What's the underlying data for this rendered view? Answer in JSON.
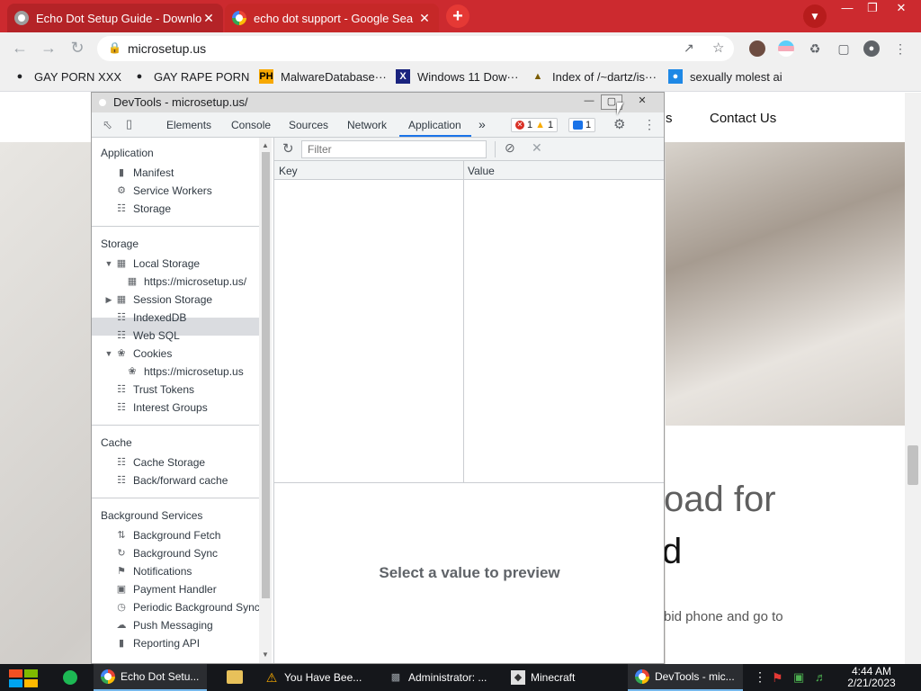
{
  "browser": {
    "tabs": [
      {
        "title": "Echo Dot Setup Guide - Downlo",
        "close": "✕"
      },
      {
        "title": "echo dot support - Google Sea",
        "close": "✕"
      }
    ],
    "new_tab": "+",
    "url": "microsetup.us",
    "accent_color": "#cc2a2f"
  },
  "bookmarks": [
    {
      "label": "GAY PORN XXX"
    },
    {
      "label": "GAY RAPE PORN"
    },
    {
      "label": "MalwareDatabase···",
      "icon_text": "PH"
    },
    {
      "label": "Windows 11 Dow···",
      "icon_text": "X"
    },
    {
      "label": "Index of /~dartz/is···"
    },
    {
      "label": "sexually molest ai"
    }
  ],
  "page": {
    "nav_partial": "s",
    "nav_contact": "Contact Us",
    "hero_line1": "oad for",
    "hero_line2": "d",
    "hero_sub": "bid phone and go to"
  },
  "devtools": {
    "window_title": "DevTools - microsetup.us/",
    "tabs": [
      "Elements",
      "Console",
      "Sources",
      "Network",
      "Application"
    ],
    "more_tabs": "»",
    "badges": {
      "errors": "1",
      "warnings": "1",
      "messages": "1"
    },
    "sidebar": {
      "application_title": "Application",
      "application_items": [
        "Manifest",
        "Service Workers",
        "Storage"
      ],
      "storage_title": "Storage",
      "local_storage": "Local Storage",
      "local_storage_origin": "https://microsetup.us/",
      "session_storage": "Session Storage",
      "indexeddb": "IndexedDB",
      "websql": "Web SQL",
      "cookies": "Cookies",
      "cookies_origin": "https://microsetup.us",
      "trust_tokens": "Trust Tokens",
      "interest_groups": "Interest Groups",
      "cache_title": "Cache",
      "cache_items": [
        "Cache Storage",
        "Back/forward cache"
      ],
      "bg_title": "Background Services",
      "bg_items": [
        "Background Fetch",
        "Background Sync",
        "Notifications",
        "Payment Handler",
        "Periodic Background Sync",
        "Push Messaging",
        "Reporting API"
      ]
    },
    "filter_placeholder": "Filter",
    "columns": {
      "key": "Key",
      "value": "Value"
    },
    "preview_text": "Select a value to preview"
  },
  "taskbar": {
    "apps": [
      "Echo Dot Setu...",
      "You Have Bee...",
      "Administrator: ...",
      "Minecraft",
      "DevTools - mic..."
    ],
    "time": "4:44 AM",
    "date": "2/21/2023"
  }
}
